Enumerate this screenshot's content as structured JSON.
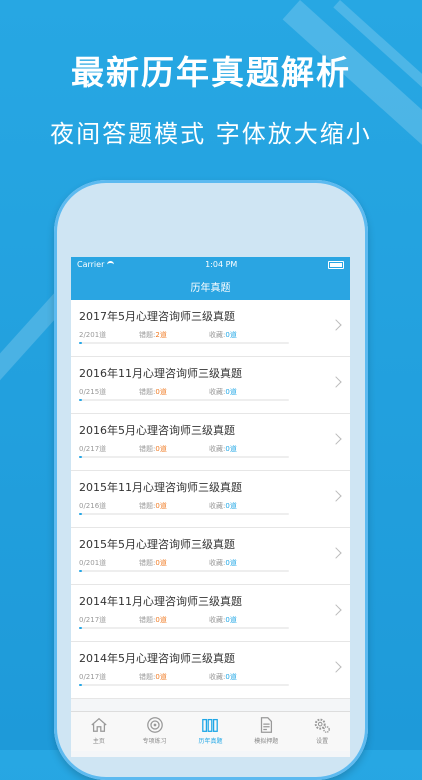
{
  "headline": "最新历年真题解析",
  "subheadline": "夜间答题模式  字体放大缩小",
  "status_bar": {
    "carrier": "Carrier",
    "time": "1:04 PM"
  },
  "nav_title": "历年真题",
  "rows": [
    {
      "title": "2017年5月心理咨询师三级真题",
      "count": "2/201道",
      "wrong_label": "错题:",
      "wrong": "2道",
      "fav_label": "收藏:",
      "fav": "0道",
      "progress": 0.01
    },
    {
      "title": "2016年11月心理咨询师三级真题",
      "count": "0/215道",
      "wrong_label": "错题:",
      "wrong": "0道",
      "fav_label": "收藏:",
      "fav": "0道",
      "progress": 0.01
    },
    {
      "title": "2016年5月心理咨询师三级真题",
      "count": "0/217道",
      "wrong_label": "错题:",
      "wrong": "0道",
      "fav_label": "收藏:",
      "fav": "0道",
      "progress": 0.01
    },
    {
      "title": "2015年11月心理咨询师三级真题",
      "count": "0/216道",
      "wrong_label": "错题:",
      "wrong": "0道",
      "fav_label": "收藏:",
      "fav": "0道",
      "progress": 0.01
    },
    {
      "title": "2015年5月心理咨询师三级真题",
      "count": "0/201道",
      "wrong_label": "错题:",
      "wrong": "0道",
      "fav_label": "收藏:",
      "fav": "0道",
      "progress": 0.01
    },
    {
      "title": "2014年11月心理咨询师三级真题",
      "count": "0/217道",
      "wrong_label": "错题:",
      "wrong": "0道",
      "fav_label": "收藏:",
      "fav": "0道",
      "progress": 0.01
    },
    {
      "title": "2014年5月心理咨询师三级真题",
      "count": "0/217道",
      "wrong_label": "错题:",
      "wrong": "0道",
      "fav_label": "收藏:",
      "fav": "0道",
      "progress": 0.01
    }
  ],
  "tabs": [
    {
      "label": "主页",
      "icon": "home-icon"
    },
    {
      "label": "专项练习",
      "icon": "target-icon"
    },
    {
      "label": "历年真题",
      "icon": "books-icon",
      "active": true
    },
    {
      "label": "模拟押题",
      "icon": "document-icon"
    },
    {
      "label": "设置",
      "icon": "gear-icon"
    }
  ],
  "colors": {
    "background": "#27a7e3",
    "accent": "#1ea6e6",
    "wrong": "#f07a22"
  }
}
